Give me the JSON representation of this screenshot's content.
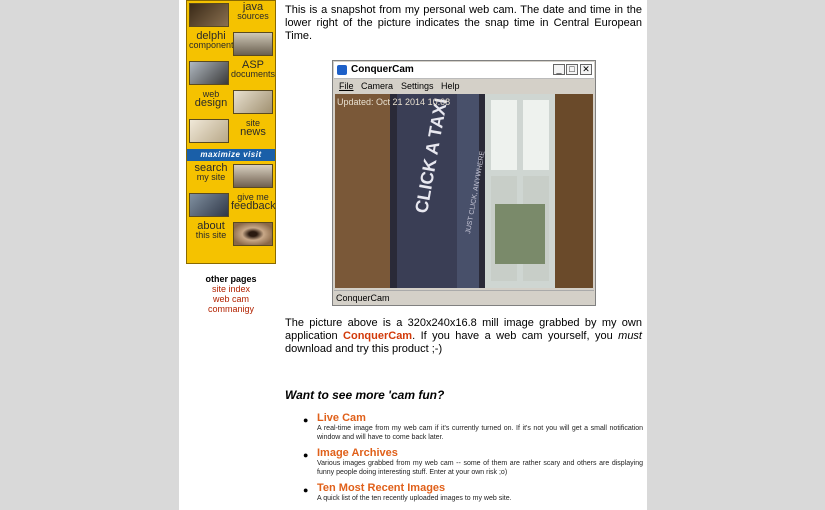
{
  "nav": {
    "rows": [
      {
        "word": "java",
        "sub": "sources"
      },
      {
        "word": "delphi",
        "sub": "components"
      },
      {
        "word": "ASP",
        "sub": "documents"
      },
      {
        "word": "design",
        "sub": "web"
      },
      {
        "word": "news",
        "sub": "site"
      },
      {
        "word": "search",
        "sub": "my site"
      },
      {
        "word": "feedback",
        "sub": "give me"
      },
      {
        "word": "about",
        "sub": "this site"
      }
    ],
    "visit_label": "maximize visit"
  },
  "side_links": {
    "header": "other pages",
    "links": [
      "site index",
      "web cam",
      "commanigy"
    ]
  },
  "intro": "This is a snapshot from my personal web cam. The date and time in the lower right of the picture indicates the snap time in Central European Time.",
  "window": {
    "title": "ConquerCam",
    "menus": [
      "File",
      "Camera",
      "Settings",
      "Help"
    ],
    "timestamp": "Updated: Oct 21 2014 10:08",
    "status": "ConquerCam",
    "sign_main": "CLICK A TAXI",
    "sign_sub": "JUST CLICK, ANYWHERE"
  },
  "para2": {
    "before": "The picture above is a 320x240x16.8 mill image grabbed by my own application ",
    "app": "ConquerCam",
    "after1": ". If you have a web cam yourself, you ",
    "must": "must",
    "after2": " download and try this product ;-)"
  },
  "more_heading": "Want to see more 'cam fun?",
  "items": [
    {
      "title": "Live Cam",
      "desc": "A real-time image from my web cam if it's currently turned on. If it's not you will get a small notification window and will have to come back later."
    },
    {
      "title": "Image Archives",
      "desc": "Various images grabbed from my web cam -- some of them are rather scary and others are displaying funny people doing interesting stuff. Enter at your own risk ;o)"
    },
    {
      "title": "Ten Most Recent Images",
      "desc": "A quick list of the ten recently uploaded images to my web site."
    }
  ],
  "colors": {
    "nav_bg": "#f5c200",
    "link": "#b22200",
    "accent": "#e0601a",
    "visit_bar": "#1a5fa8"
  }
}
